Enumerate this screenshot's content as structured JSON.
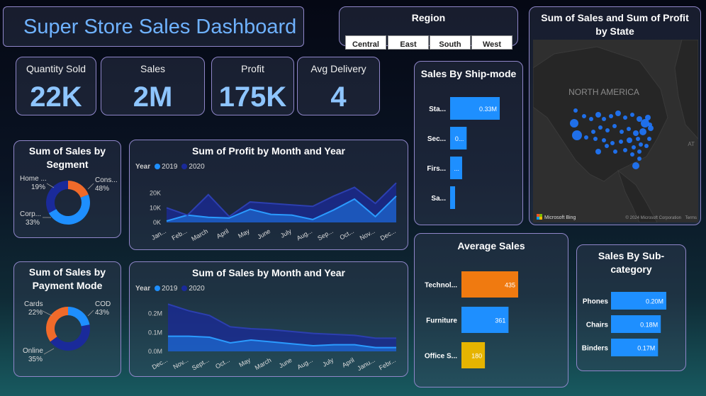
{
  "header": {
    "title": "Super Store Sales Dashboard"
  },
  "region_slicer": {
    "title": "Region",
    "options": [
      "Central",
      "East",
      "South",
      "West"
    ]
  },
  "kpis": [
    {
      "label": "Quantity Sold",
      "value": "22K"
    },
    {
      "label": "Sales",
      "value": "2M"
    },
    {
      "label": "Profit",
      "value": "175K"
    },
    {
      "label": "Avg Delivery",
      "value": "4"
    }
  ],
  "map": {
    "title": "Sum of Sales and Sum of Profit by State",
    "region_label": "NORTH AMERICA",
    "edge_label": "AT",
    "bing": "Microsoft Bing",
    "copyright": "© 2024 Microsoft Corporation",
    "terms": "Terms",
    "color": "#1f78ff"
  },
  "legend_year_label": "Year",
  "colors": {
    "y2019": "#1e8fff",
    "y2020": "#1a2a9a",
    "orange": "#f07a10",
    "blue": "#1e8fff",
    "gold": "#e6b400",
    "navy": "#1a2a9a",
    "orange2": "#f06a2a"
  },
  "chart_data": [
    {
      "id": "segment",
      "type": "pie",
      "title": "Sum of Sales by Segment",
      "labels": [
        "Home ...",
        "Cons...",
        "Corp..."
      ],
      "values": [
        19,
        48,
        33
      ],
      "pct_labels": [
        "19%",
        "48%",
        "33%"
      ],
      "colors": [
        "#f06a2a",
        "#1e8fff",
        "#1a2a9a"
      ]
    },
    {
      "id": "payment",
      "type": "pie",
      "title": "Sum of Sales by Payment Mode",
      "labels": [
        "Cards",
        "COD",
        "Online"
      ],
      "values": [
        22,
        43,
        35
      ],
      "pct_labels": [
        "22%",
        "43%",
        "35%"
      ],
      "colors": [
        "#1e8fff",
        "#1a2a9a",
        "#f06a2a"
      ]
    },
    {
      "id": "profit_month",
      "type": "area",
      "title": "Sum of Profit by Month and Year",
      "categories": [
        "Jan...",
        "Feb...",
        "March",
        "April",
        "May",
        "June",
        "July",
        "Aug...",
        "Sep...",
        "Oct...",
        "Nov...",
        "Dec..."
      ],
      "series": [
        {
          "name": "2019",
          "values": [
            1000,
            5000,
            3500,
            3000,
            9000,
            5500,
            5000,
            2000,
            8500,
            16000,
            4000,
            18000
          ]
        },
        {
          "name": "2020",
          "values": [
            10000,
            5000,
            19000,
            4000,
            14000,
            13000,
            12000,
            11000,
            18000,
            24000,
            13000,
            27000
          ]
        }
      ],
      "yticks": [
        0,
        10000,
        20000
      ],
      "ytick_labels": [
        "0K",
        "10K",
        "20K"
      ],
      "ylim": [
        0,
        30000
      ]
    },
    {
      "id": "sales_month",
      "type": "area",
      "title": "Sum of Sales by Month and Year",
      "categories": [
        "Dec...",
        "Nov...",
        "Sept...",
        "Oct...",
        "May",
        "March",
        "June",
        "Aug...",
        "July",
        "April",
        "Janu...",
        "Febr..."
      ],
      "series": [
        {
          "name": "2019",
          "values": [
            0.08,
            0.08,
            0.075,
            0.045,
            0.06,
            0.05,
            0.04,
            0.03,
            0.035,
            0.035,
            0.02,
            0.02
          ]
        },
        {
          "name": "2020",
          "values": [
            0.25,
            0.215,
            0.19,
            0.13,
            0.12,
            0.115,
            0.105,
            0.095,
            0.09,
            0.085,
            0.07,
            0.07
          ]
        }
      ],
      "yticks": [
        0,
        0.1,
        0.2
      ],
      "ytick_labels": [
        "0.0M",
        "0.1M",
        "0.2M"
      ],
      "ylim": [
        0,
        0.27
      ]
    },
    {
      "id": "shipmode",
      "type": "bar",
      "title": "Sales By Ship-mode",
      "categories": [
        "Sta...",
        "Sec...",
        "Firs...",
        "Sa..."
      ],
      "values": [
        0.33,
        0.11,
        0.08,
        0.03
      ],
      "value_labels": [
        "0.33M",
        "0...",
        "...",
        ""
      ]
    },
    {
      "id": "avg_sales",
      "type": "bar",
      "title": "Average Sales",
      "categories": [
        "Technol...",
        "Furniture",
        "Office S..."
      ],
      "values": [
        435,
        361,
        180
      ],
      "value_labels": [
        "435",
        "361",
        "180"
      ],
      "colors": [
        "#f07a10",
        "#1e8fff",
        "#e6b400"
      ]
    },
    {
      "id": "subcat",
      "type": "bar",
      "title": "Sales By Sub-category",
      "categories": [
        "Phones",
        "Chairs",
        "Binders"
      ],
      "values": [
        0.2,
        0.18,
        0.17
      ],
      "value_labels": [
        "0.20M",
        "0.18M",
        "0.17M"
      ]
    }
  ]
}
